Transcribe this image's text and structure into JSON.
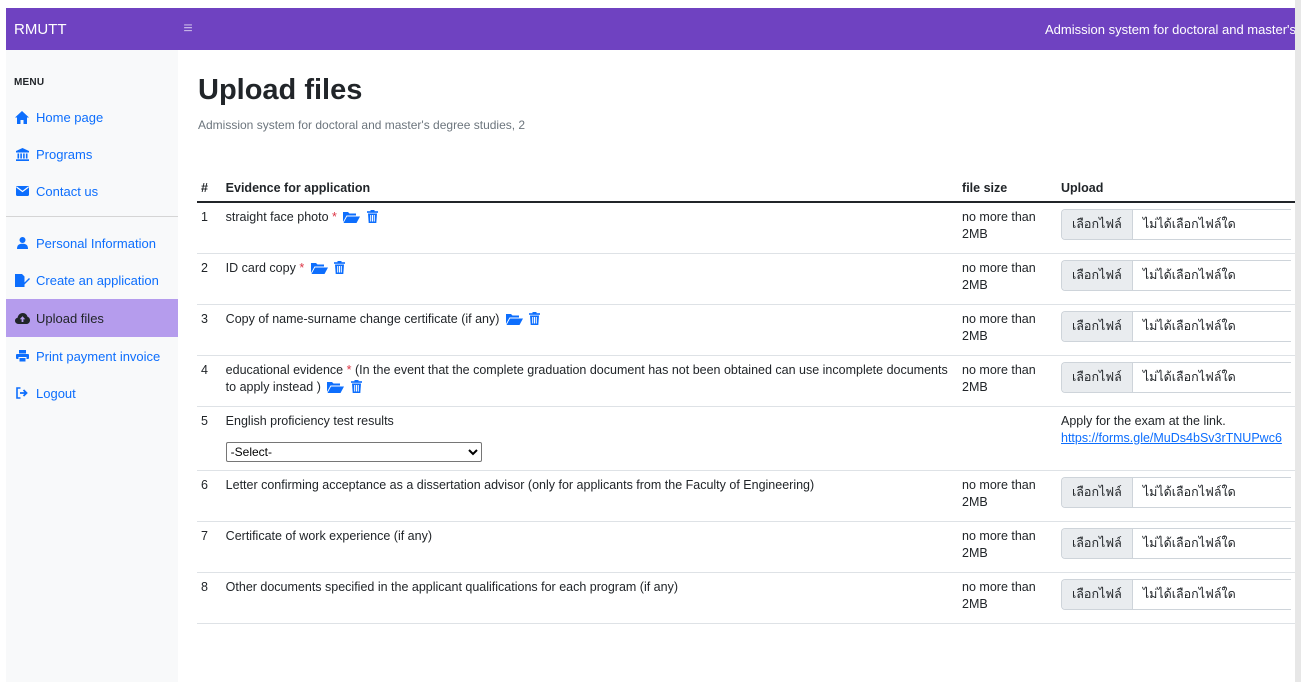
{
  "header": {
    "brand": "RMUTT",
    "title": "Admission system for doctoral and master's"
  },
  "sidebar": {
    "menu_heading": "MENU",
    "items": [
      {
        "label": "Home page",
        "icon": "home-icon"
      },
      {
        "label": "Programs",
        "icon": "institution-icon"
      },
      {
        "label": "Contact us",
        "icon": "envelope-icon"
      },
      {
        "label": "Personal Information",
        "icon": "user-icon"
      },
      {
        "label": "Create an application",
        "icon": "file-signature-icon"
      },
      {
        "label": "Upload files",
        "icon": "cloud-upload-icon",
        "active": true
      },
      {
        "label": "Print payment invoice",
        "icon": "print-icon"
      },
      {
        "label": "Logout",
        "icon": "sign-out-icon"
      }
    ]
  },
  "page": {
    "title": "Upload files",
    "subtitle": "Admission system for doctoral and master's degree studies, 2"
  },
  "table": {
    "headers": {
      "num": "#",
      "evidence": "Evidence for application",
      "size": "file size",
      "upload": "Upload"
    },
    "file_button": "เลือกไฟล์",
    "file_status": "ไม่ได้เลือกไฟล์ใด",
    "rows": [
      {
        "num": "1",
        "text": "straight face photo",
        "required": "*",
        "note": "",
        "size": "no more than 2MB"
      },
      {
        "num": "2",
        "text": "ID card copy",
        "required": "*",
        "note": "",
        "size": "no more than 2MB"
      },
      {
        "num": "3",
        "text": "Copy of name-surname change certificate (if any)",
        "required": "",
        "note": "",
        "size": "no more than 2MB"
      },
      {
        "num": "4",
        "text": "educational evidence",
        "required": "*",
        "note": "(In the event that the complete graduation document has not been obtained can use incomplete documents to apply instead )",
        "size": "no more than 2MB"
      },
      {
        "num": "5",
        "text": "English proficiency test results",
        "select_value": "-Select-",
        "apply_text": "Apply for the exam at the link.",
        "apply_link": "https://forms.gle/MuDs4bSv3rTNUPwc6"
      },
      {
        "num": "6",
        "text": "Letter confirming acceptance as a dissertation advisor (only for applicants from the Faculty of Engineering)",
        "size": "no more than 2MB"
      },
      {
        "num": "7",
        "text": "Certificate of work experience (if any)",
        "size": "no more than 2MB"
      },
      {
        "num": "8",
        "text": "Other documents specified in the applicant qualifications for each program (if any)",
        "size": "no more than 2MB"
      }
    ]
  },
  "colors": {
    "topbar": "#6f42c1",
    "active_nav": "#b59ced",
    "link": "#0d6efd",
    "required": "#dc3545"
  }
}
